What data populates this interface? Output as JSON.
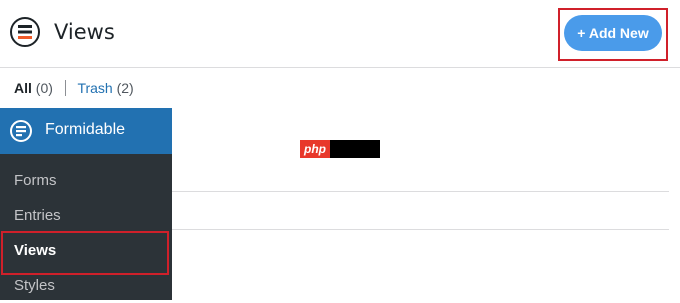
{
  "header": {
    "title": "Views",
    "add_new_label": "+ Add New"
  },
  "filters": {
    "all_label": "All",
    "all_count": "(0)",
    "trash_label": "Trash",
    "trash_count": "(2)"
  },
  "sidebar": {
    "title": "Formidable",
    "items": [
      {
        "label": "Forms"
      },
      {
        "label": "Entries"
      },
      {
        "label": "Views"
      },
      {
        "label": "Styles"
      }
    ]
  },
  "badge": {
    "text": "php"
  },
  "colors": {
    "accent": "#4a9bea",
    "sidebar_head": "#2271b1",
    "sidebar_bg": "#2c3338",
    "highlight": "#d0202a"
  }
}
